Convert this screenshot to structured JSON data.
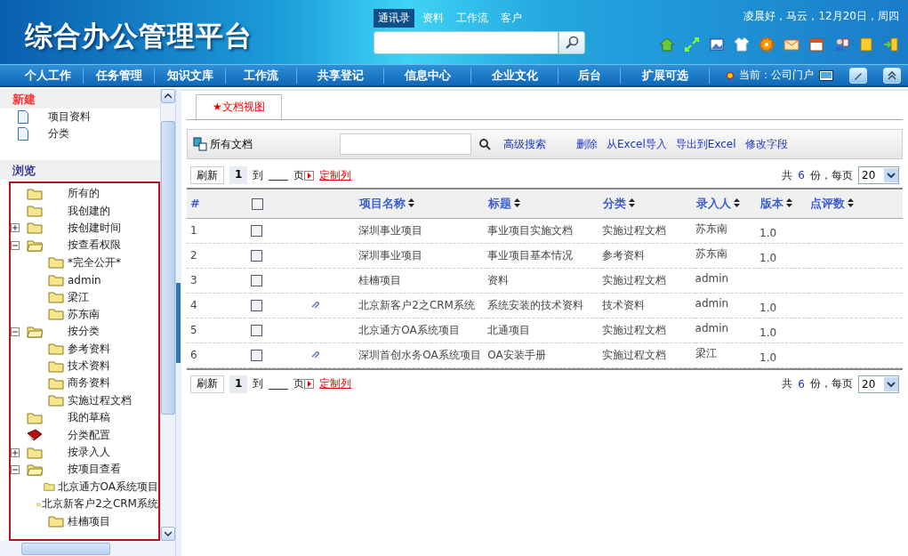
{
  "header": {
    "title": "综合办公管理平台",
    "greeting": "凌晨好，马云，12月20日，周四",
    "search_tabs": [
      {
        "label": "通讯录",
        "selected": true
      },
      {
        "label": "资料",
        "selected": false
      },
      {
        "label": "工作流",
        "selected": false
      },
      {
        "label": "客户",
        "selected": false
      }
    ]
  },
  "nav": {
    "items": [
      "个人工作",
      "任务管理",
      "知识文库",
      "工作流",
      "共享登记",
      "信息中心",
      "企业文化",
      "后台",
      "扩展可选"
    ],
    "current": "当前：公司门户"
  },
  "sidebar": {
    "new_title": "新建",
    "new_items": [
      "项目资料",
      "分类"
    ],
    "browse_title": "浏览",
    "tree": [
      {
        "label": "所有的",
        "kind": "leaf"
      },
      {
        "label": "我创建的",
        "kind": "leaf"
      },
      {
        "label": "按创建时间",
        "kind": "group",
        "expanded": false
      },
      {
        "label": "按查看权限",
        "kind": "group",
        "expanded": true,
        "children": [
          {
            "label": "*完全公开*",
            "kind": "leaf"
          },
          {
            "label": "admin",
            "kind": "leaf"
          },
          {
            "label": "梁江",
            "kind": "leaf"
          },
          {
            "label": "苏东南",
            "kind": "leaf"
          }
        ]
      },
      {
        "label": "按分类",
        "kind": "group",
        "expanded": true,
        "children": [
          {
            "label": "参考资料",
            "kind": "leaf"
          },
          {
            "label": "技术资料",
            "kind": "leaf"
          },
          {
            "label": "商务资料",
            "kind": "leaf"
          },
          {
            "label": "实施过程文档",
            "kind": "leaf"
          }
        ]
      },
      {
        "label": "我的草稿",
        "kind": "leaf"
      },
      {
        "label": "分类配置",
        "kind": "book"
      },
      {
        "label": "按录入人",
        "kind": "group",
        "expanded": false
      },
      {
        "label": "按项目查看",
        "kind": "group",
        "expanded": true,
        "children": [
          {
            "label": "北京通方OA系统项目",
            "kind": "leaf"
          },
          {
            "label": "北京新客户2之CRM系统",
            "kind": "leaf"
          },
          {
            "label": "桂楠项目",
            "kind": "leaf"
          }
        ]
      }
    ]
  },
  "main": {
    "tab": "★文档视图",
    "view_title": "所有文档",
    "actions": [
      "高级搜索",
      "删除",
      "从Excel导入",
      "导出到Excel",
      "修改字段"
    ],
    "pagers": [
      {
        "refresh": "刷新",
        "page": "1",
        "to": "到",
        "page_unit": "页",
        "customize": "定制列",
        "total_prefix": "共",
        "total": "6",
        "total_suffix": "份，每页",
        "per_page": "20"
      },
      {
        "refresh": "刷新",
        "page": "1",
        "to": "到",
        "page_unit": "页",
        "customize": "定制列",
        "total_prefix": "共",
        "total": "6",
        "total_suffix": "份，每页",
        "per_page": "20"
      }
    ],
    "select_all": {
      "checked": false
    },
    "columns": [
      "#",
      "项目名称",
      "标题",
      "分类",
      "录入人",
      "版本",
      "点评数"
    ],
    "rows": [
      {
        "num": "1",
        "checked": false,
        "attachment": false,
        "project": "深圳事业项目",
        "title": "事业项目实施文档",
        "category": "实施过程文档",
        "author": "苏东南",
        "version": "1.0"
      },
      {
        "num": "2",
        "checked": false,
        "attachment": false,
        "project": "深圳事业项目",
        "title": "事业项目基本情况",
        "category": "参考资料",
        "author": "苏东南",
        "version": "1.0"
      },
      {
        "num": "3",
        "checked": false,
        "attachment": false,
        "project": "桂楠项目",
        "title": "资料",
        "category": "实施过程文档",
        "author": "admin"
      },
      {
        "num": "4",
        "checked": false,
        "attachment": true,
        "project": "北京新客户2之CRM系统",
        "title": "系统安装的技术资料",
        "category": "技术资料",
        "author": "admin",
        "version": "1.0"
      },
      {
        "num": "5",
        "checked": false,
        "attachment": false,
        "project": "北京通方OA系统项目",
        "title": "北通项目",
        "category": "实施过程文档",
        "author": "admin",
        "version": "1.0"
      },
      {
        "num": "6",
        "checked": false,
        "attachment": true,
        "project": "深圳首创水务OA系统项目",
        "title": "OA安装手册",
        "category": "实施过程文档",
        "author": "梁江",
        "version": "1.0"
      }
    ]
  }
}
